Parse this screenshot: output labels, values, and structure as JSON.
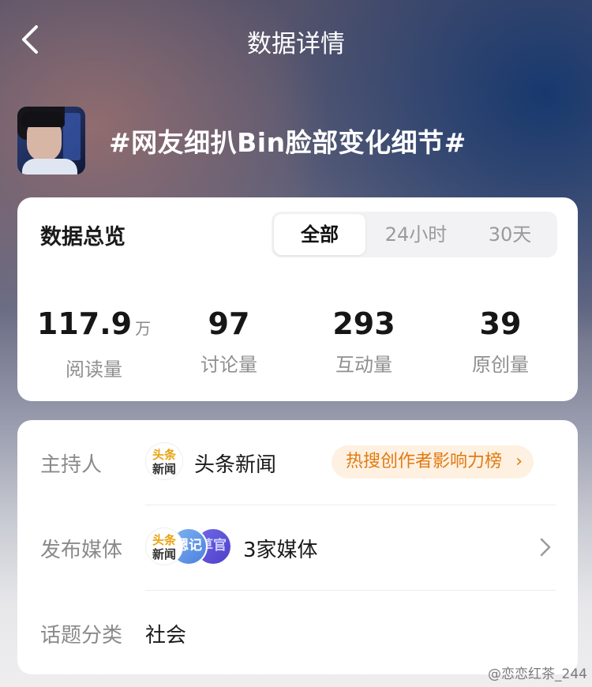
{
  "header": {
    "title": "数据详情"
  },
  "topic": {
    "title": "#网友细扒Bin脸部变化细节#"
  },
  "overview": {
    "title": "数据总览",
    "tabs": [
      {
        "label": "全部",
        "active": true
      },
      {
        "label": "24小时",
        "active": false
      },
      {
        "label": "30天",
        "active": false
      }
    ],
    "stats": [
      {
        "value": "117.9",
        "unit": "万",
        "label": "阅读量"
      },
      {
        "value": "97",
        "unit": "",
        "label": "讨论量"
      },
      {
        "value": "293",
        "unit": "",
        "label": "互动量"
      },
      {
        "value": "39",
        "unit": "",
        "label": "原创量"
      }
    ]
  },
  "info": {
    "host": {
      "label": "主持人",
      "logo_top": "头条",
      "logo_bottom": "新闻",
      "name": "头条新闻",
      "rank_badge": "热搜创作者影响力榜"
    },
    "media": {
      "label": "发布媒体",
      "logo1_top": "头条",
      "logo1_bottom": "新闻",
      "logo2_text": "嗯记",
      "logo3_text": "草官",
      "count_text": "3家媒体"
    },
    "category": {
      "label": "话题分类",
      "value": "社会"
    }
  },
  "watermark": "@恋恋红茶_244",
  "colors": {
    "accent_orange": "#e07a12",
    "pill_bg": "#fff1e2",
    "logo_gold": "#e8a310"
  }
}
